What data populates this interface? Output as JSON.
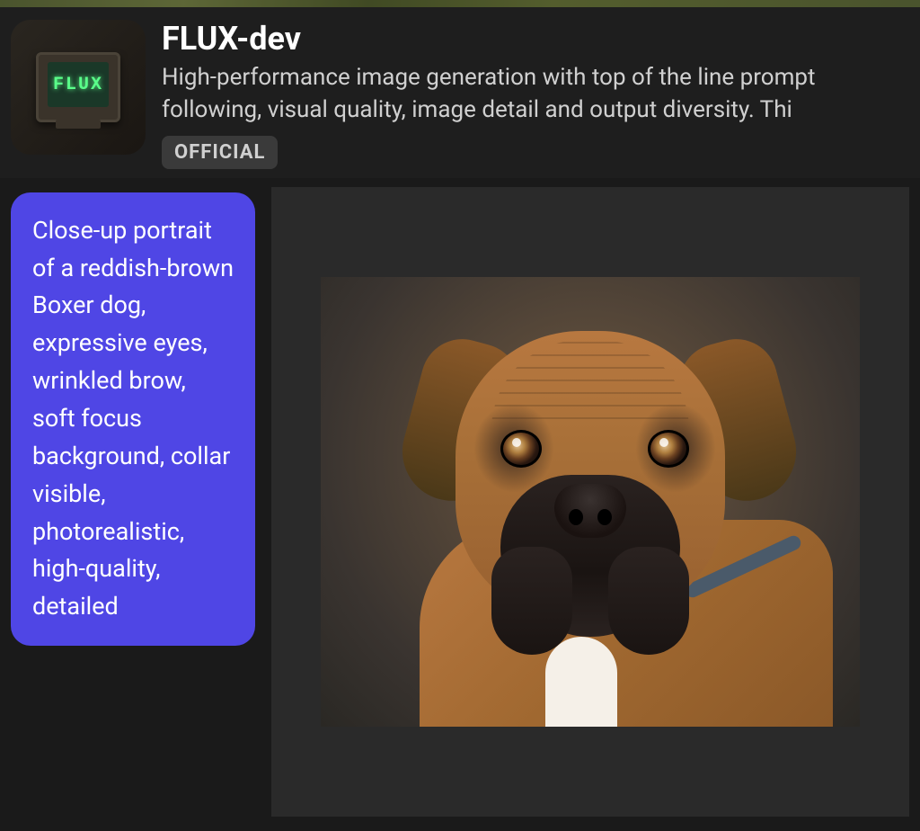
{
  "header": {
    "icon_label": "FLUX",
    "title": "FLUX-dev",
    "description": "High-performance image generation with top of the line prompt following, visual quality, image detail and output diversity. Thi",
    "badge": "OFFICIAL"
  },
  "prompt": {
    "text": "Close-up portrait of a reddish-brown Boxer dog, expressive eyes, wrinkled brow, soft focus background, collar visible, photorealistic, high-quality, detailed"
  },
  "image": {
    "alt": "Generated close-up portrait of a reddish-brown Boxer dog"
  }
}
